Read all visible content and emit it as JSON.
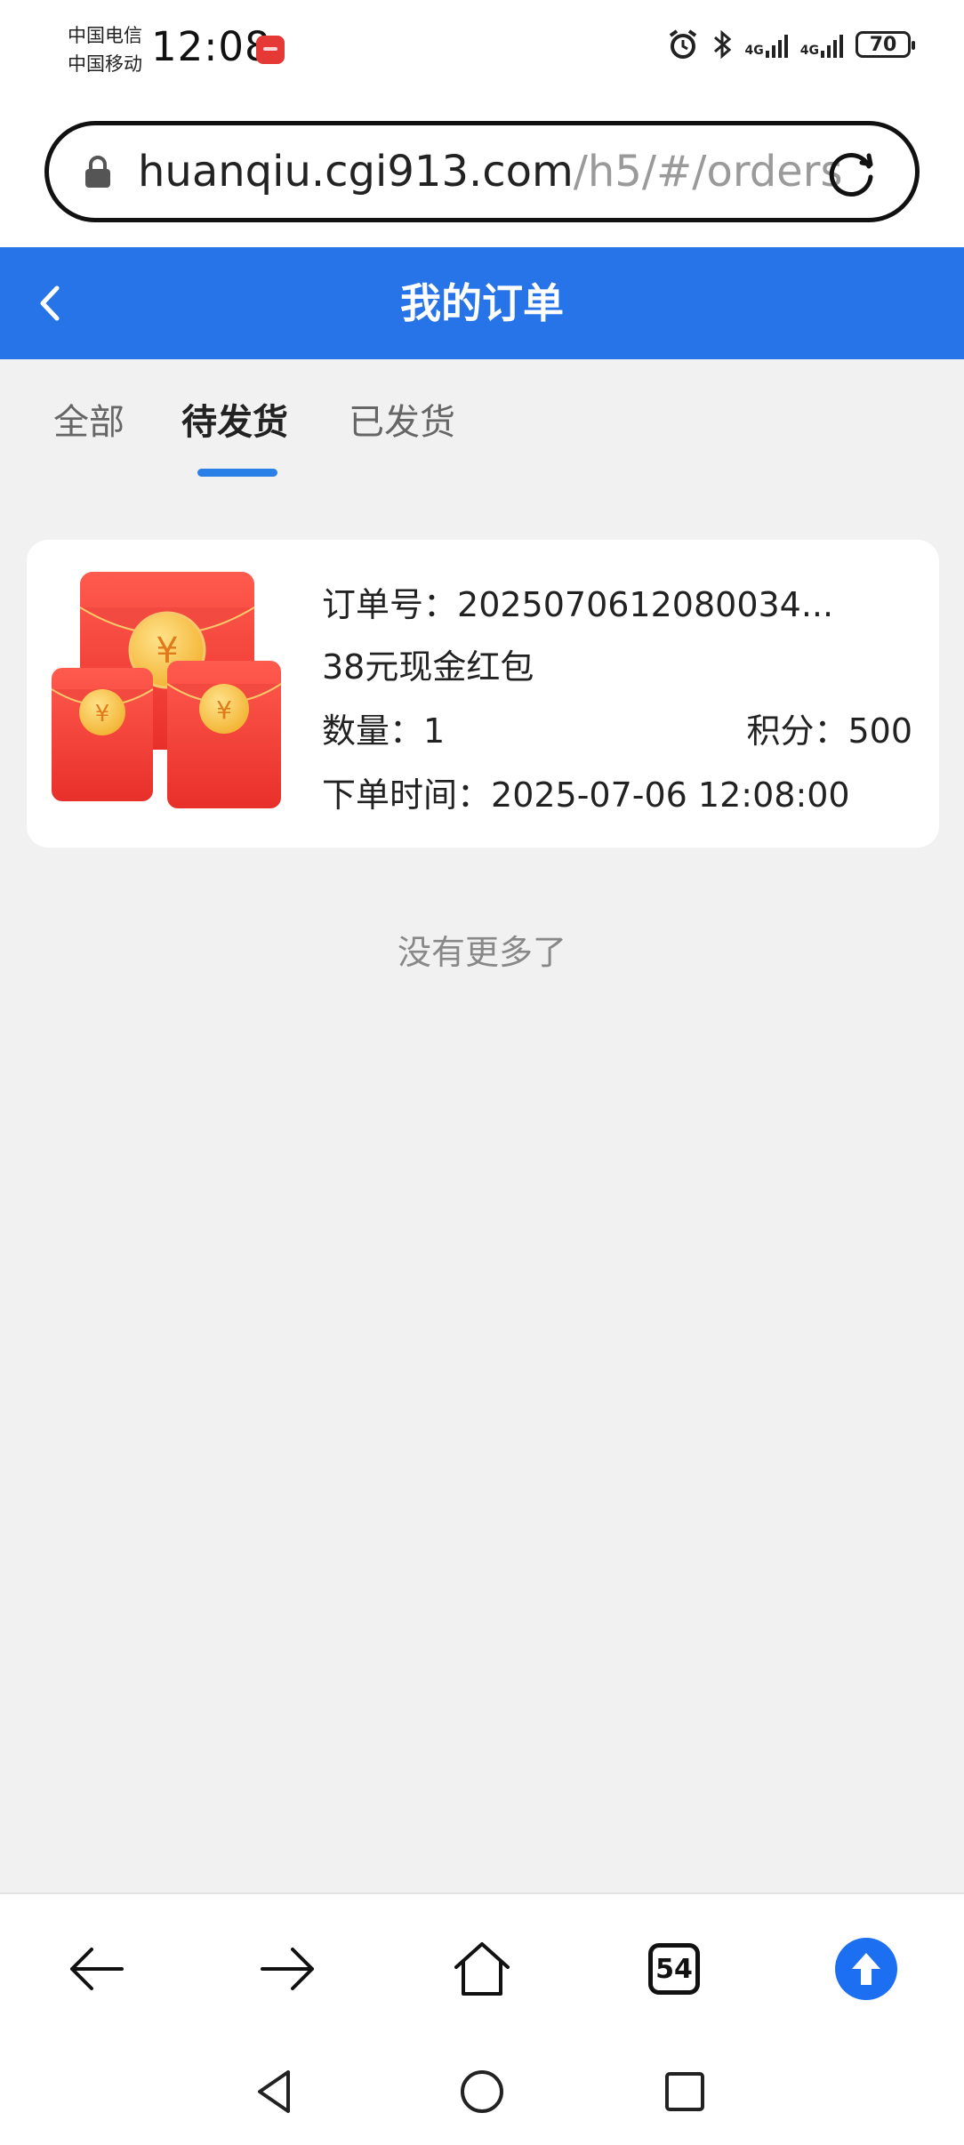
{
  "status_bar": {
    "carrier_1": "中国电信",
    "carrier_2": "中国移动",
    "time": "12:08",
    "network_1": "4G",
    "network_2": "4G",
    "battery": "70"
  },
  "browser": {
    "url_host": "huanqiu.cgi913.com",
    "url_path": "/h5/#/orders",
    "tab_count": "54"
  },
  "header": {
    "title": "我的订单"
  },
  "tabs": [
    {
      "label": "全部",
      "active": false
    },
    {
      "label": "待发货",
      "active": true
    },
    {
      "label": "已发货",
      "active": false
    }
  ],
  "orders": [
    {
      "order_no_label": "订单号：",
      "order_no": "2025070612080034...",
      "product": "38元现金红包",
      "qty_label": "数量：",
      "qty": "1",
      "points_label": "积分：",
      "points": "500",
      "time_label": "下单时间：",
      "time": "2025-07-06 12:08:00",
      "image_icon": "red-envelope-icon"
    }
  ],
  "list_end_text": "没有更多了",
  "colors": {
    "header_bg": "#2774e8",
    "tab_indicator": "#2a80e6",
    "envelope_red": "#f0413a",
    "coin_gold": "#f7c040",
    "upload_blue": "#1d6ff2"
  }
}
